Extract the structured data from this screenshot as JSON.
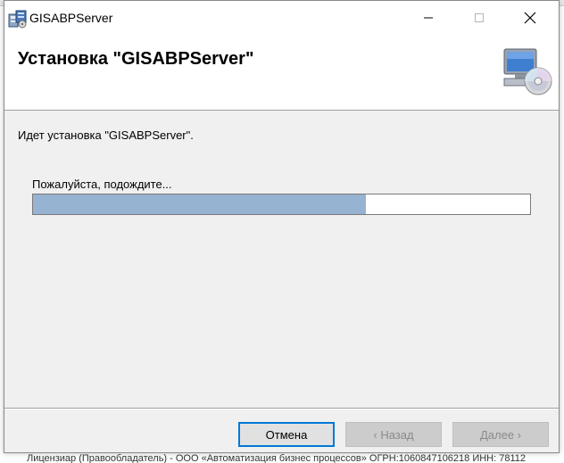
{
  "window": {
    "title": "GISABPServer"
  },
  "header": {
    "title": "Установка \"GISABPServer\""
  },
  "main": {
    "status_text": "Идет установка \"GISABPServer\".",
    "wait_text": "Пожалуйста, подождите...",
    "progress_fraction": 0.67
  },
  "buttons": {
    "cancel": "Отмена",
    "back": "‹ Назад",
    "next": "Далее ›"
  },
  "background": {
    "footer_text": "Лицензиар (Правообладатель) - ООО «Автоматизация бизнес процессов» ОГРН:1060847106218 ИНН: 78112"
  },
  "colors": {
    "progress_fill": "#97b3d2",
    "default_button_border": "#0078d7"
  },
  "icons": {
    "app": "installer-package-icon",
    "header": "computer-cd-icon",
    "minimize": "minimize-icon",
    "maximize": "maximize-icon",
    "close": "close-icon"
  }
}
